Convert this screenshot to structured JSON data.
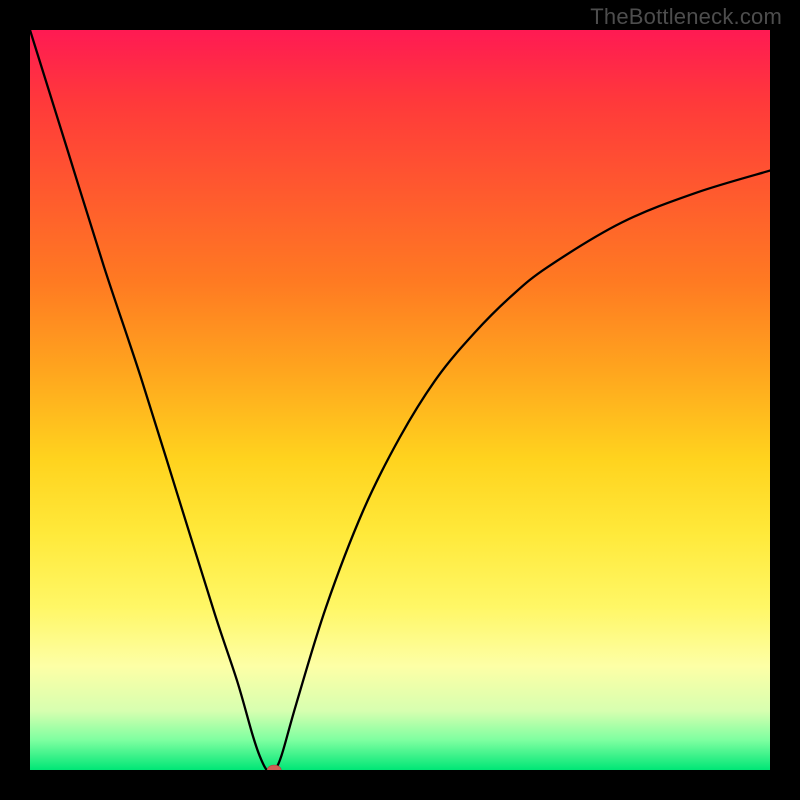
{
  "watermark": "TheBottleneck.com",
  "chart_data": {
    "type": "line",
    "title": "",
    "xlabel": "",
    "ylabel": "",
    "xlim": [
      0,
      100
    ],
    "ylim": [
      0,
      100
    ],
    "x": [
      0,
      5,
      10,
      15,
      20,
      25,
      28,
      30,
      31,
      32,
      33,
      34,
      36,
      40,
      45,
      50,
      55,
      60,
      65,
      70,
      80,
      90,
      100
    ],
    "values": [
      100,
      84,
      68,
      53,
      37,
      21,
      12,
      5,
      2,
      0,
      0,
      2,
      9,
      22,
      35,
      45,
      53,
      59,
      64,
      68,
      74,
      78,
      81
    ],
    "marker": {
      "x": 33,
      "y": 0,
      "color": "#cf5f55",
      "rx": 7,
      "ry": 5
    },
    "gradient_stops": [
      {
        "y": 0,
        "color": "#ff1a53"
      },
      {
        "y": 70,
        "color": "#ffe93a"
      },
      {
        "y": 95,
        "color": "#7dffa0"
      },
      {
        "y": 100,
        "color": "#00e676"
      }
    ]
  }
}
